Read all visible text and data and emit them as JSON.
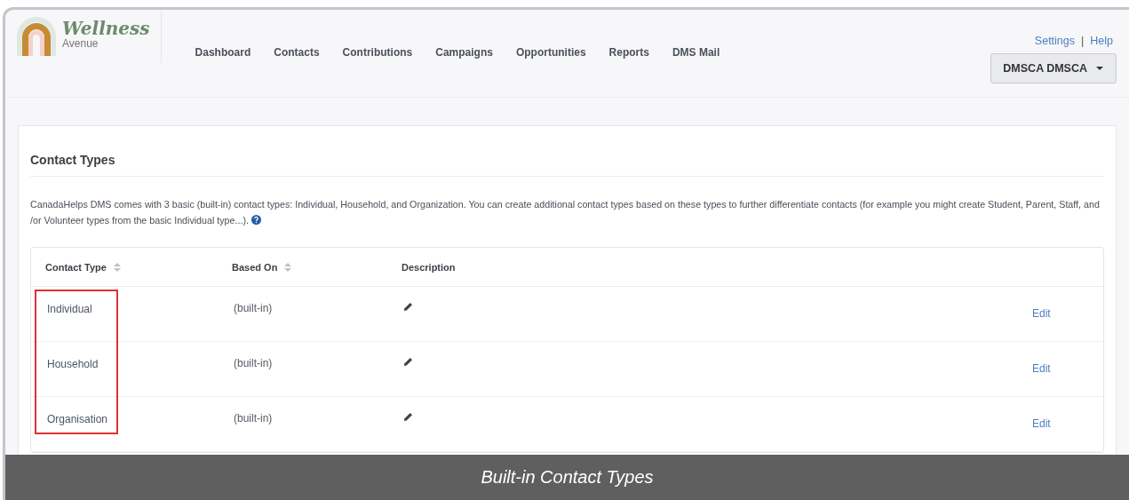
{
  "logo": {
    "title": "Wellness",
    "subtitle": "Avenue"
  },
  "nav": [
    {
      "label": "Dashboard",
      "selected": false
    },
    {
      "label": "Contacts",
      "selected": false
    },
    {
      "label": "Contributions",
      "selected": false
    },
    {
      "label": "Campaigns",
      "selected": false
    },
    {
      "label": "Opportunities",
      "selected": false
    },
    {
      "label": "Reports",
      "selected": false
    },
    {
      "label": "DMS Mail",
      "selected": false
    }
  ],
  "top_links": [
    "Settings",
    "|",
    "Help"
  ],
  "user_menu": {
    "label": "DMSCA DMSCA"
  },
  "page_title": "Contact Types",
  "intro": "CanadaHelps DMS comes with 3 basic (built-in) contact types: Individual, Household, and Organization. You can create additional contact types based on these types to further differentiate contacts (for example you might create Student, Parent, Staff, and /or Volunteer types from the basic Individual type...).",
  "table": {
    "columns": [
      {
        "label": "Contact Type",
        "sortable": true
      },
      {
        "label": "Based On",
        "sortable": true
      },
      {
        "label": "Description",
        "sortable": false
      }
    ],
    "rows": [
      {
        "contact_type": "Individual",
        "based_on": "(built-in)",
        "action": "Edit"
      },
      {
        "contact_type": "Household",
        "based_on": "(built-in)",
        "action": "Edit"
      },
      {
        "contact_type": "Organisation",
        "based_on": "(built-in)",
        "action": "Edit"
      }
    ]
  },
  "caption": "Built-in Contact Types"
}
